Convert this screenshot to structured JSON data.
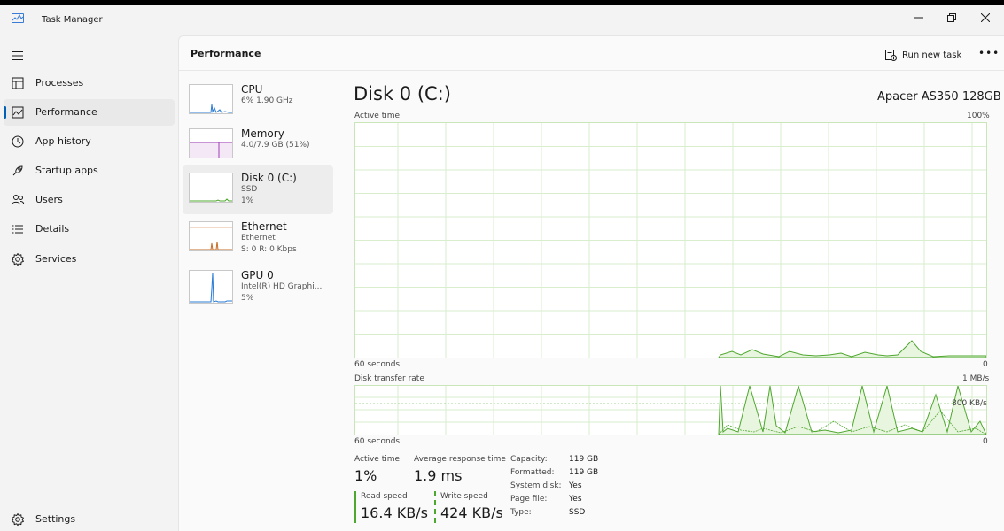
{
  "app": {
    "title": "Task Manager"
  },
  "sidebar": {
    "items": [
      {
        "label": "Processes",
        "icon": "processes-icon"
      },
      {
        "label": "Performance",
        "icon": "performance-icon",
        "active": true
      },
      {
        "label": "App history",
        "icon": "app-history-icon"
      },
      {
        "label": "Startup apps",
        "icon": "startup-apps-icon"
      },
      {
        "label": "Users",
        "icon": "users-icon"
      },
      {
        "label": "Details",
        "icon": "details-icon"
      },
      {
        "label": "Services",
        "icon": "services-icon"
      }
    ],
    "settings": "Settings"
  },
  "header": {
    "title": "Performance",
    "run_new_task": "Run new task"
  },
  "devices": [
    {
      "name": "CPU",
      "sub1": "6% 1.90 GHz",
      "sub2": ""
    },
    {
      "name": "Memory",
      "sub1": "4.0/7.9 GB (51%)",
      "sub2": ""
    },
    {
      "name": "Disk 0 (C:)",
      "sub1": "SSD",
      "sub2": "1%"
    },
    {
      "name": "Ethernet",
      "sub1": "Ethernet",
      "sub2": "S: 0 R: 0 Kbps"
    },
    {
      "name": "GPU 0",
      "sub1": "Intel(R) HD Graphi...",
      "sub2": "5%"
    }
  ],
  "disk": {
    "title": "Disk 0 (C:)",
    "model": "Apacer AS350 128GB",
    "active_time_label": "Active time",
    "active_time_max": "100%",
    "graph1_left": "60 seconds",
    "graph1_right": "0",
    "transfer_label": "Disk transfer rate",
    "transfer_max": "1 MB/s",
    "transfer_mid": "800 KB/s",
    "graph2_left": "60 seconds",
    "graph2_right": "0"
  },
  "stats": {
    "active_time_label": "Active time",
    "active_time_value": "1%",
    "avg_response_label": "Average response time",
    "avg_response_value": "1.9 ms",
    "read_label": "Read speed",
    "read_value": "16.4 KB/s",
    "write_label": "Write speed",
    "write_value": "424 KB/s"
  },
  "properties": [
    {
      "key": "Capacity:",
      "value": "119 GB"
    },
    {
      "key": "Formatted:",
      "value": "119 GB"
    },
    {
      "key": "System disk:",
      "value": "Yes"
    },
    {
      "key": "Page file:",
      "value": "Yes"
    },
    {
      "key": "Type:",
      "value": "SSD"
    }
  ],
  "colors": {
    "accent": "#005fb8",
    "disk_green": "#4ea72e",
    "grid_green": "#d9eecd"
  }
}
